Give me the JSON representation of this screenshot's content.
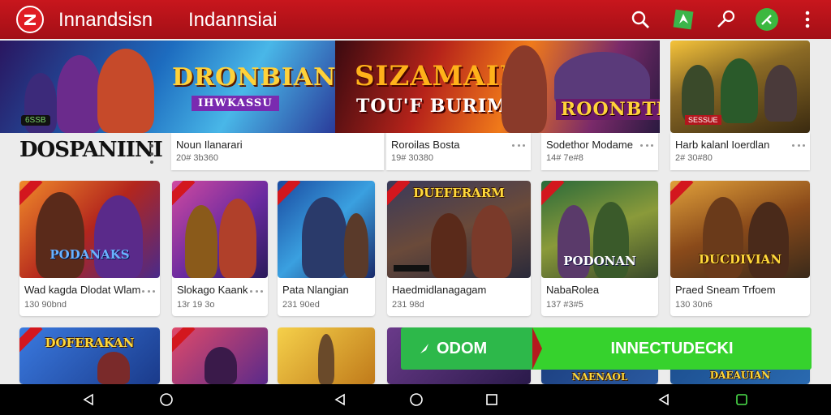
{
  "header": {
    "app_title": "Innandsisn",
    "app_subtitle": "Indannsiai",
    "accent_color": "#c8161d",
    "icons": [
      "logo-icon",
      "search-icon",
      "store-icon",
      "key-icon",
      "share-icon",
      "more-vert-icon"
    ]
  },
  "banners": [
    {
      "title": "DRONBIAN",
      "subtitle": "IHWKASSU",
      "badge": "6SSB"
    },
    {
      "title": "SIZAMAIN",
      "subtitle": "TOU'F BURIMAN",
      "tag": "ROONBTIAN"
    },
    {
      "tag": "SESSUE"
    }
  ],
  "section": {
    "title": "DOSPANIINI"
  },
  "text_cards": [
    {
      "title": "Noun Ilanarari",
      "meta": "20# 3b360"
    },
    {
      "title": "Roroilas Bosta",
      "meta": "19# 30380"
    },
    {
      "title": "Sodethor Modame",
      "meta": "14# 7e#8"
    },
    {
      "title": "Harb kalanl Ioerdlan",
      "meta": "2# 30#80"
    }
  ],
  "cards_row1": [
    {
      "thumb_label": "PODANAKS",
      "title": "Wad kagda Dlodat Wlam",
      "meta": "130 90bnd"
    },
    {
      "thumb_label": "",
      "title": "Slokago Kaank",
      "meta": "13r 19 3o"
    },
    {
      "thumb_label": "",
      "title": "Pata Nlangian",
      "meta": "231 90ed"
    },
    {
      "thumb_label": "DUEFERARM",
      "title": "Haedmidlanagagam",
      "meta": "231 98d"
    },
    {
      "thumb_label": "PODONAN",
      "title": "NabaRolea",
      "meta": "137 #3#5"
    },
    {
      "thumb_label": "DUCDIVIAN",
      "title": "Praed Sneam Trfoem",
      "meta": "130 30n6"
    }
  ],
  "cards_row2": [
    {
      "thumb_label": "DOFERAKAN"
    },
    {
      "thumb_label": ""
    },
    {
      "thumb_label": ""
    },
    {
      "thumb_label": ""
    },
    {
      "thumb_label": "NAENAOL"
    },
    {
      "thumb_label": "DAEAUIAN"
    }
  ],
  "cta": {
    "left_label": "ODOM",
    "right_label": "INNECTUDECKI"
  },
  "navbar": {
    "icons": [
      "back-icon",
      "home-icon",
      "back-icon",
      "home-icon",
      "recents-icon",
      "back-icon",
      "recents-icon"
    ]
  }
}
